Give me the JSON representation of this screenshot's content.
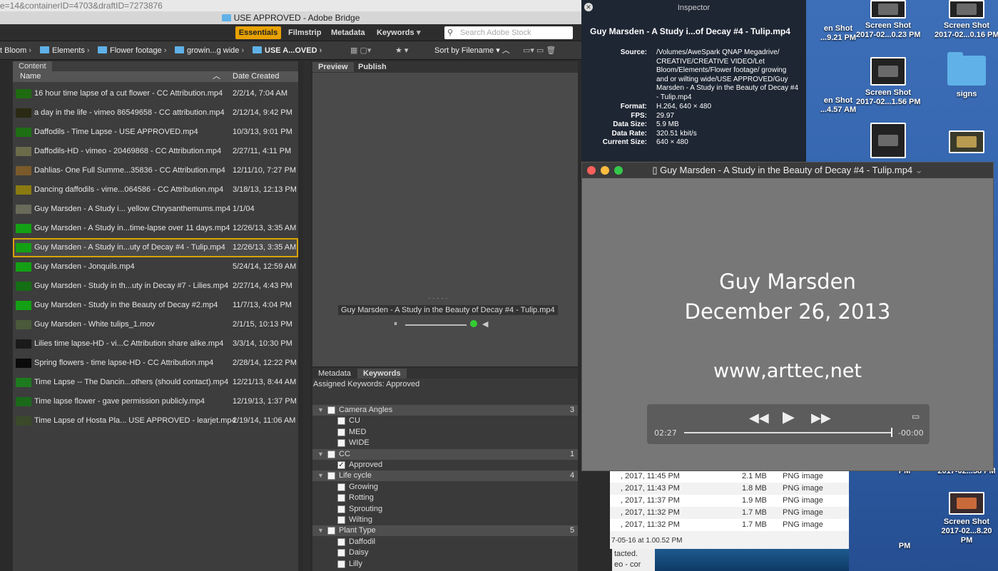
{
  "browser": {
    "url_fragment": "e=14&containerID=4703&draftID=7273876"
  },
  "window": {
    "title": "USE APPROVED - Adobe Bridge"
  },
  "workspaces": [
    "Essentials",
    "Filmstrip",
    "Metadata",
    "Keywords"
  ],
  "search": {
    "placeholder": "Search Adobe Stock"
  },
  "breadcrumb": [
    "t Bloom",
    "Elements",
    "Flower footage",
    "growin...g wide",
    "USE A...OVED"
  ],
  "sort_label": "Sort by Filename",
  "content_panel": {
    "tab": "Content",
    "col_name": "Name",
    "col_date": "Date Created",
    "files": [
      {
        "name": "16 hour time lapse of a cut flower - CC Attribution.mp4",
        "date": "2/2/14, 7:04 AM",
        "thumb": "#1f6b12"
      },
      {
        "name": "a day in the life - vimeo 86549658 - CC attribution.mp4",
        "date": "2/12/14, 9:42 PM",
        "thumb": "#2a2a14"
      },
      {
        "name": "Daffodils - Time Lapse - USE APPROVED.mp4",
        "date": "10/3/13, 9:01 PM",
        "thumb": "#1e6e14"
      },
      {
        "name": "Daffodils-HD - vimeo - 20469868 - CC Attribution.mp4",
        "date": "2/27/11, 4:11 PM",
        "thumb": "#6b6b4a"
      },
      {
        "name": "Dahlias- One Full Summe...35836 - CC Attribution.mp4",
        "date": "12/11/10, 7:27 PM",
        "thumb": "#7a5a2a"
      },
      {
        "name": "Dancing daffodils - vime...064586 - CC Attribution.mp4",
        "date": "3/18/13, 12:13 PM",
        "thumb": "#8a7a10"
      },
      {
        "name": "Guy Marsden - A Study i... yellow Chrysanthemums.mp4",
        "date": "1/1/04",
        "thumb": "#6a6a5a"
      },
      {
        "name": "Guy Marsden - A Study in...time-lapse over 11 days.mp4",
        "date": "12/26/13, 3:35 AM",
        "thumb": "#14a014"
      },
      {
        "name": "Guy Marsden - A Study in...uty of Decay #4 - Tulip.mp4",
        "date": "12/26/13, 3:35 AM",
        "thumb": "#14a014"
      },
      {
        "name": "Guy Marsden - Jonquils.mp4",
        "date": "5/24/14, 12:59 AM",
        "thumb": "#14a014"
      },
      {
        "name": "Guy Marsden - Study in th...uty in Decay #7 - Lilies.mp4",
        "date": "2/27/14, 4:43 PM",
        "thumb": "#146e14"
      },
      {
        "name": "Guy Marsden - Study in the Beauty of Decay #2.mp4",
        "date": "11/7/13, 4:04 PM",
        "thumb": "#14a014"
      },
      {
        "name": "Guy Marsden - White tulips_1.mov",
        "date": "2/1/15, 10:13 PM",
        "thumb": "#4a5a3a"
      },
      {
        "name": "Lilies time lapse-HD - vi...C Attribution share alike.mp4",
        "date": "3/3/14, 10:30 PM",
        "thumb": "#1a1a1a"
      },
      {
        "name": "Spring flowers - time lapse-HD - CC Attribution.mp4",
        "date": "2/28/14, 12:22 PM",
        "thumb": "#0a0a0a"
      },
      {
        "name": "Time Lapse -- The Dancin...others (should contact).mp4",
        "date": "12/21/13, 8:44 AM",
        "thumb": "#1e7a1e"
      },
      {
        "name": "Time lapse flower - gave permission publicly.mp4",
        "date": "12/19/13, 1:37 PM",
        "thumb": "#1a6a1a"
      },
      {
        "name": "Time Lapse of Hosta Pla... USE APPROVED - learjet.mp4",
        "date": "2/19/14, 11:06 AM",
        "thumb": "#3a4a2a"
      }
    ],
    "selected_index": 8
  },
  "preview_panel": {
    "tabs": [
      "Preview",
      "Publish"
    ],
    "caption": "Guy Marsden - A Study in the Beauty of Decay #4 - Tulip.mp4",
    "dots": "· · · · ·"
  },
  "keywords_panel": {
    "tabs": [
      "Metadata",
      "Keywords"
    ],
    "assigned": "Assigned Keywords: Approved",
    "items": [
      {
        "label": "Camera Angles",
        "cat": true,
        "count": "3",
        "checked": false
      },
      {
        "label": "CU",
        "cat": false,
        "checked": false
      },
      {
        "label": "MED",
        "cat": false,
        "checked": false
      },
      {
        "label": "WIDE",
        "cat": false,
        "checked": false
      },
      {
        "label": "CC",
        "cat": true,
        "count": "1",
        "checked": false
      },
      {
        "label": "Approved",
        "cat": false,
        "checked": true
      },
      {
        "label": "Life cycle",
        "cat": true,
        "count": "4",
        "checked": false
      },
      {
        "label": "Growing",
        "cat": false,
        "checked": false
      },
      {
        "label": "Rotting",
        "cat": false,
        "checked": false
      },
      {
        "label": "Sprouting",
        "cat": false,
        "checked": false
      },
      {
        "label": "Wilting",
        "cat": false,
        "checked": false
      },
      {
        "label": "Plant Type",
        "cat": true,
        "count": "5",
        "checked": false
      },
      {
        "label": "Daffodil",
        "cat": false,
        "checked": false
      },
      {
        "label": "Daisy",
        "cat": false,
        "checked": false
      },
      {
        "label": "Lilly",
        "cat": false,
        "checked": false
      }
    ]
  },
  "inspector": {
    "title": "Inspector",
    "filename": "Guy Marsden - A Study i...of Decay #4 - Tulip.mp4",
    "source_label": "Source:",
    "source": "/Volumes/AweSpark QNAP Megadrive/ CREATIVE/CREATIVE VIDEO/Let Bloom/Elements/Flower footage/ growing and or wilting wide/USE APPROVED/Guy Marsden - A Study in the Beauty of Decay #4 - Tulip.mp4",
    "fields": [
      {
        "label": "Format:",
        "value": "H.264, 640 × 480"
      },
      {
        "label": "FPS:",
        "value": "29.97"
      },
      {
        "label": "Data Size:",
        "value": "5.9 MB"
      },
      {
        "label": "Data Rate:",
        "value": "320.51 kbit/s"
      },
      {
        "label": "Current Size:",
        "value": "640 × 480"
      }
    ]
  },
  "player": {
    "title": "Guy Marsden - A Study in the Beauty of Decay #4 - Tulip.mp4",
    "line1": "Guy Marsden",
    "line2": "December 26, 2013",
    "line3": "www,arttec,net",
    "elapsed": "02:27",
    "remaining": "-00:00",
    "progress": 1.0
  },
  "desktop": {
    "icons": [
      {
        "label": "en Shot\n...9.21 PM"
      },
      {
        "label": "Screen Shot\n2017-02...0.23 PM"
      },
      {
        "label": "Screen Shot\n2017-02...0.16 PM"
      },
      {
        "label": "en Shot\n...4.57 AM"
      },
      {
        "label": "Screen Shot\n2017-02...1.56 PM"
      },
      {
        "label": "signs"
      },
      {
        "label": "PM"
      },
      {
        "label": "2017-02...38 PM"
      },
      {
        "label": "Screen Shot"
      },
      {
        "label": "PM"
      },
      {
        "label": "2017-02...8.20 PM"
      }
    ]
  },
  "finder": {
    "rows": [
      {
        "date": ", 2017, 11:45 PM",
        "size": "2.1 MB",
        "kind": "PNG image"
      },
      {
        "date": ", 2017, 11:43 PM",
        "size": "1.8 MB",
        "kind": "PNG image"
      },
      {
        "date": ", 2017, 11:37 PM",
        "size": "1.9 MB",
        "kind": "PNG image"
      },
      {
        "date": ", 2017, 11:32 PM",
        "size": "1.7 MB",
        "kind": "PNG image"
      },
      {
        "date": ", 2017, 11:32 PM",
        "size": "1.7 MB",
        "kind": "PNG image"
      }
    ],
    "status": "7-05-16 at 1.00.52 PM",
    "side1": "tacted.",
    "side2": "eo - cor"
  }
}
